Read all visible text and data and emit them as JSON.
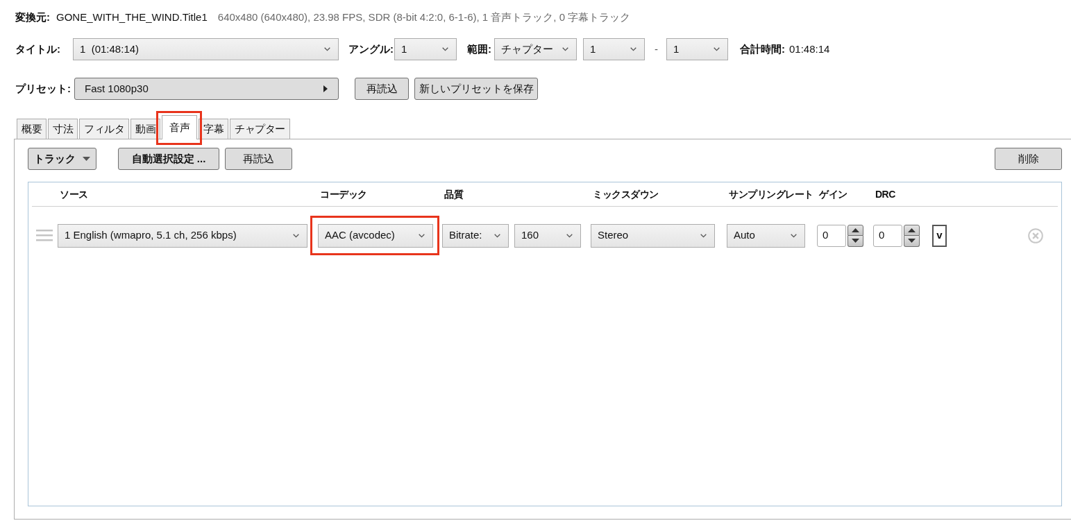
{
  "source": {
    "label": "変換元:",
    "title": "GONE_WITH_THE_WIND.Title1",
    "info": "640x480 (640x480), 23.98 FPS, SDR (8-bit 4:2:0, 6-1-6), 1 音声トラック, 0 字幕トラック"
  },
  "title_row": {
    "title_label": "タイトル:",
    "title_value": "1  (01:48:14)",
    "angle_label": "アングル:",
    "angle_value": "1",
    "range_label": "範囲:",
    "range_type": "チャプター",
    "range_start": "1",
    "range_separator": "-",
    "range_end": "1",
    "duration_label": "合計時間:",
    "duration_value": "01:48:14"
  },
  "preset_row": {
    "label": "プリセット:",
    "value": "Fast 1080p30",
    "reload_button": "再読込",
    "save_button": "新しいプリセットを保存"
  },
  "tabs": [
    {
      "label": "概要",
      "selected": false,
      "highlighted": false
    },
    {
      "label": "寸法",
      "selected": false,
      "highlighted": false
    },
    {
      "label": "フィルタ",
      "selected": false,
      "highlighted": false
    },
    {
      "label": "動画",
      "selected": false,
      "highlighted": false
    },
    {
      "label": "音声",
      "selected": true,
      "highlighted": true
    },
    {
      "label": "字幕",
      "selected": false,
      "highlighted": false
    },
    {
      "label": "チャプター",
      "selected": false,
      "highlighted": false
    }
  ],
  "toolbar": {
    "track_button": "トラック",
    "auto_select_button": "自動選択設定 ...",
    "reload_button": "再読込",
    "delete_button": "削除"
  },
  "columns": [
    "ソース",
    "コーデック",
    "品質",
    "ミックスダウン",
    "サンプリングレート",
    "ゲイン",
    "DRC"
  ],
  "tracks": [
    {
      "source": "1 English (wmapro, 5.1 ch, 256 kbps)",
      "codec": "AAC (avcodec)",
      "codec_highlighted": true,
      "quality_mode": "Bitrate:",
      "bitrate": "160",
      "mixdown": "Stereo",
      "samplerate": "Auto",
      "gain": "0",
      "drc": "0",
      "option": "v"
    }
  ]
}
